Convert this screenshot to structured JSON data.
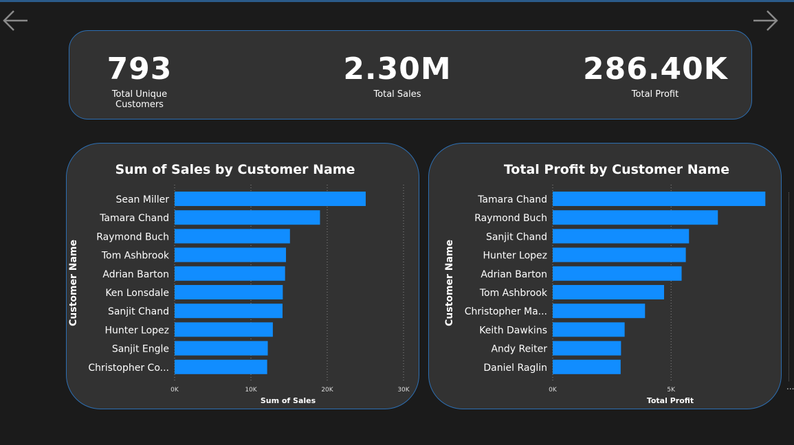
{
  "navigation": {
    "back_icon": "arrow-left-icon",
    "forward_icon": "arrow-right-icon"
  },
  "kpis": [
    {
      "value": "793",
      "label": "Total Unique Customers"
    },
    {
      "value": "2.30M",
      "label": "Total Sales"
    },
    {
      "value": "286.40K",
      "label": "Total Profit"
    }
  ],
  "more_indicator": "...",
  "colors": {
    "bar": "#118DFF",
    "card": "#323232",
    "border": "#2D6FB3",
    "background": "#1B1B1B"
  },
  "chart_data": [
    {
      "type": "bar",
      "orientation": "horizontal",
      "title": "Sum of Sales by Customer Name",
      "xlabel": "Sum of Sales",
      "ylabel": "Customer Name",
      "categories": [
        "Sean Miller",
        "Tamara Chand",
        "Raymond Buch",
        "Tom Ashbrook",
        "Adrian Barton",
        "Ken Lonsdale",
        "Sanjit Chand",
        "Hunter Lopez",
        "Sanjit Engle",
        "Christopher Co..."
      ],
      "values": [
        25043,
        19052,
        15117,
        14596,
        14474,
        14175,
        14142,
        12873,
        12209,
        12129
      ],
      "xlim": [
        0,
        30000
      ],
      "ticks": [
        0,
        10000,
        20000,
        30000
      ],
      "tick_labels": [
        "0K",
        "10K",
        "20K",
        "30K"
      ],
      "grid": true
    },
    {
      "type": "bar",
      "orientation": "horizontal",
      "title": "Total Profit by Customer Name",
      "xlabel": "Total Profit",
      "ylabel": "Customer Name",
      "categories": [
        "Tamara Chand",
        "Raymond Buch",
        "Sanjit Chand",
        "Hunter Lopez",
        "Adrian Barton",
        "Tom Ashbrook",
        "Christopher Ma...",
        "Keith Dawkins",
        "Andy Reiter",
        "Daniel Raglin"
      ],
      "values": [
        8981,
        6976,
        5757,
        5622,
        5445,
        4704,
        3899,
        3038,
        2885,
        2869
      ],
      "xlim": [
        0,
        10000
      ],
      "ticks": [
        0,
        5000
      ],
      "tick_labels": [
        "0K",
        "5K"
      ],
      "grid": true
    }
  ]
}
